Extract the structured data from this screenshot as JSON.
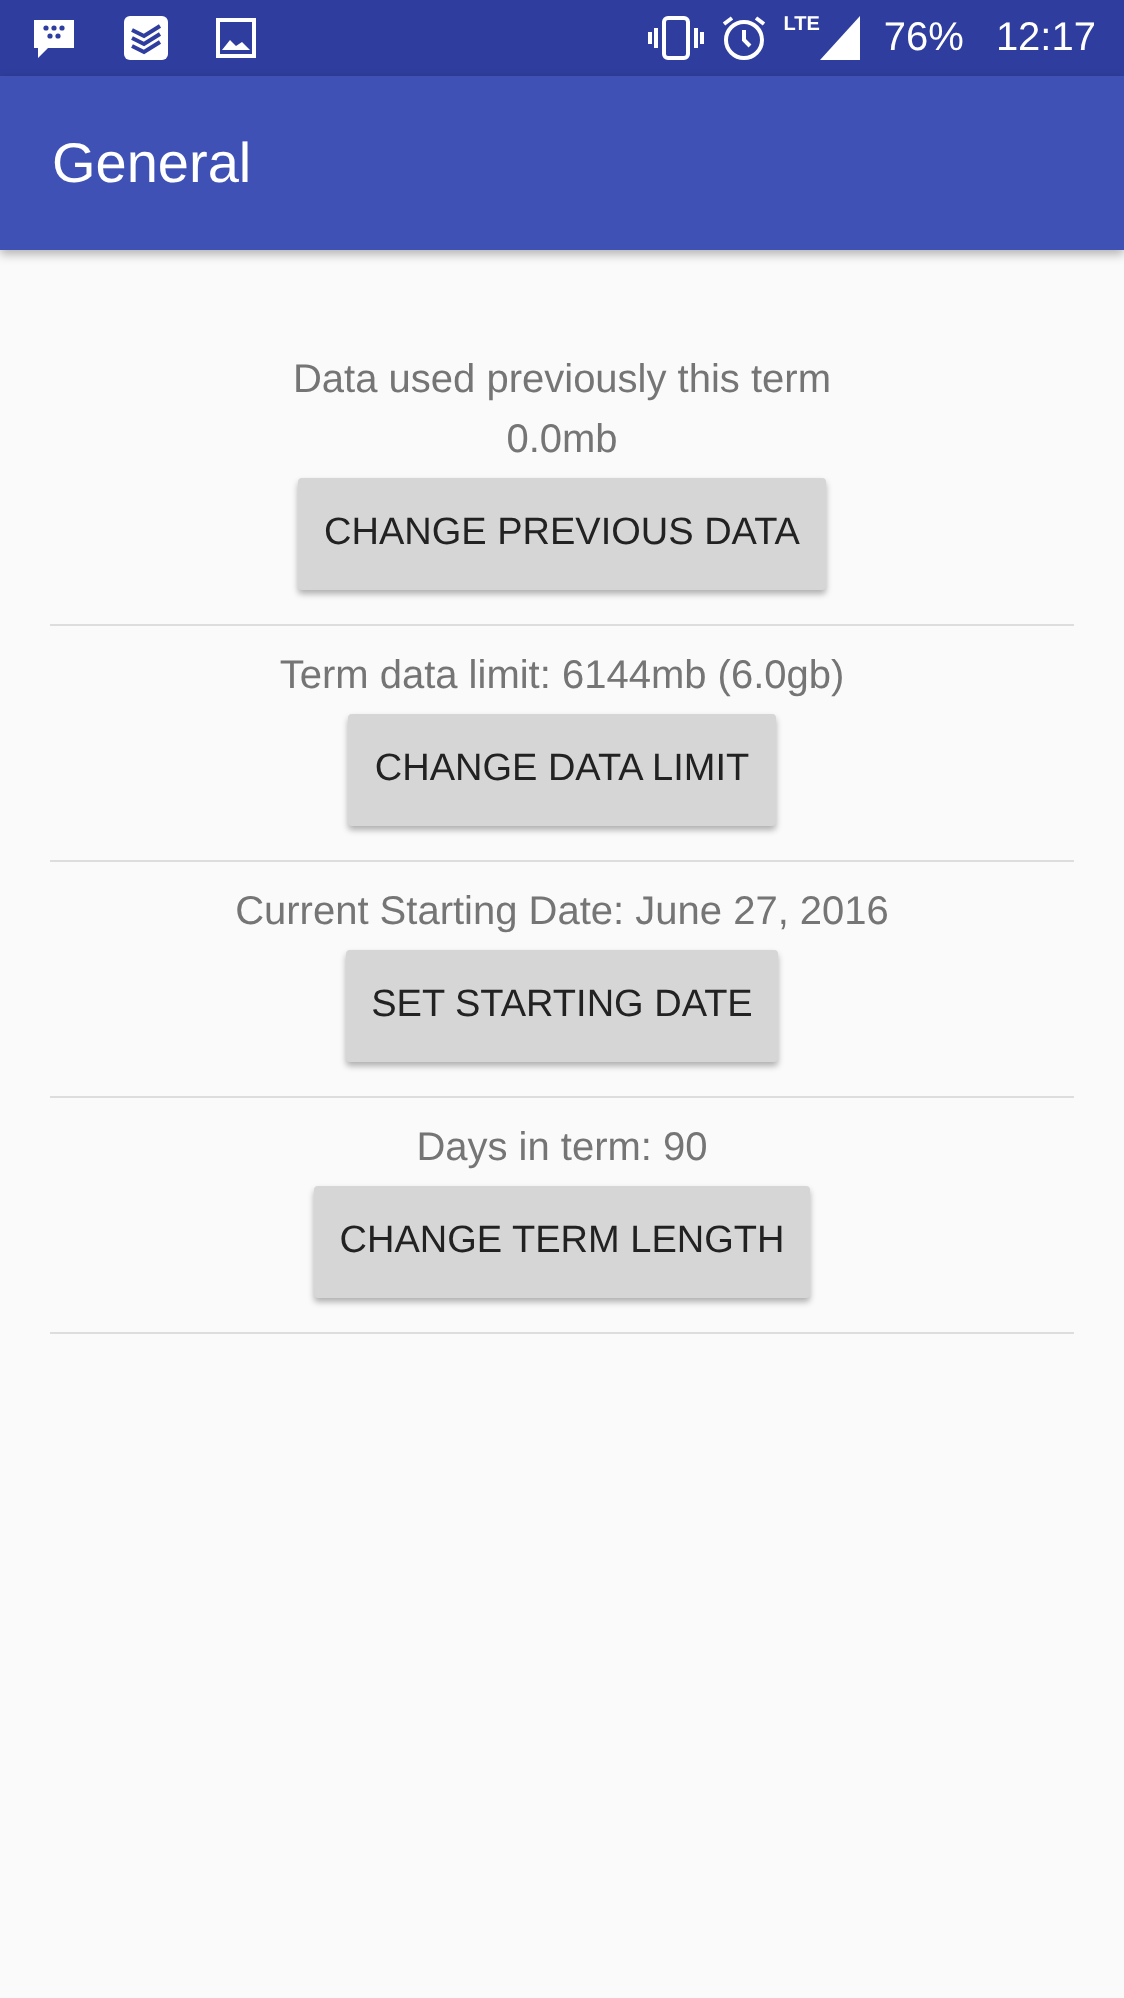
{
  "status_bar": {
    "network": "LTE",
    "battery": "76%",
    "time": "12:17"
  },
  "app_bar": {
    "title": "General"
  },
  "settings": [
    {
      "label": "Data used previously this term",
      "value": "0.0mb",
      "button": "CHANGE PREVIOUS DATA"
    },
    {
      "label": "Term data limit: 6144mb (6.0gb)",
      "button": "CHANGE DATA LIMIT"
    },
    {
      "label": "Current Starting Date: June 27, 2016",
      "button": "SET STARTING DATE"
    },
    {
      "label": "Days in term: 90",
      "button": "CHANGE TERM LENGTH"
    }
  ]
}
